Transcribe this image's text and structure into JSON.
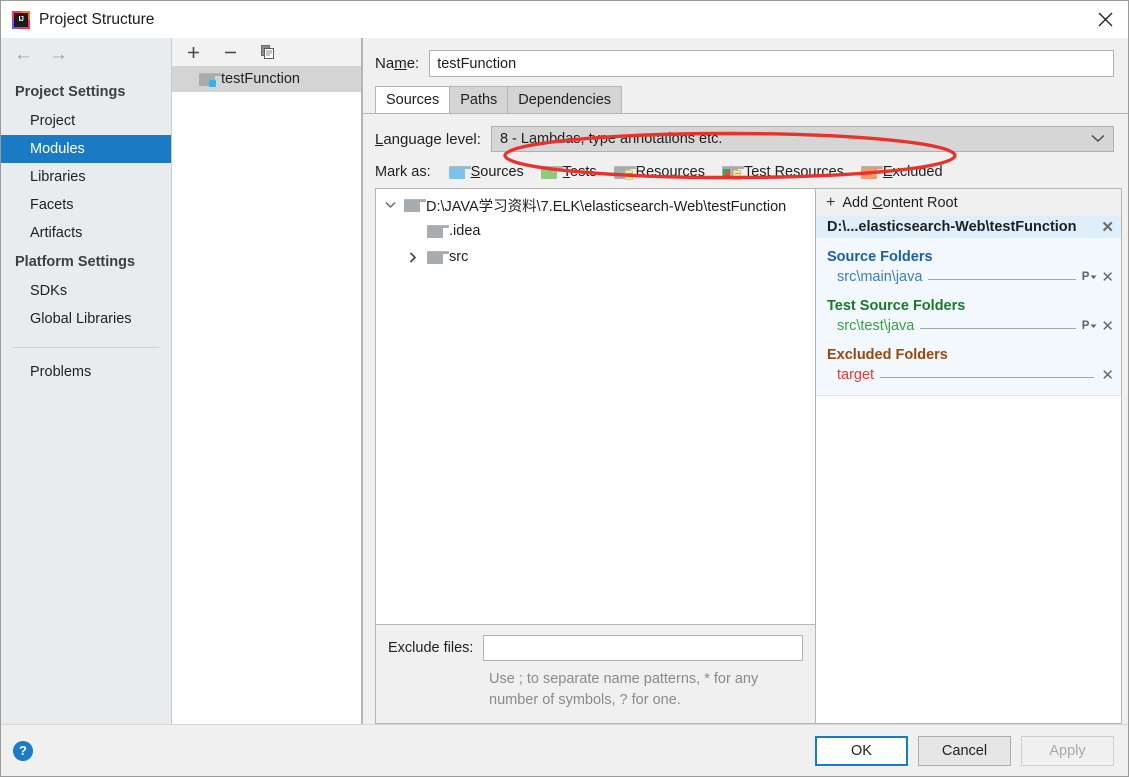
{
  "window": {
    "title": "Project Structure",
    "logo_icon": "intellij-idea-logo",
    "close_icon": "close-icon"
  },
  "sidebar": {
    "back_icon": "arrow-left-icon",
    "forward_icon": "arrow-right-icon",
    "groups": [
      {
        "label": "Project Settings",
        "items": [
          {
            "label": "Project",
            "selected": false
          },
          {
            "label": "Modules",
            "selected": true
          },
          {
            "label": "Libraries",
            "selected": false
          },
          {
            "label": "Facets",
            "selected": false
          },
          {
            "label": "Artifacts",
            "selected": false
          }
        ]
      },
      {
        "label": "Platform Settings",
        "items": [
          {
            "label": "SDKs",
            "selected": false
          },
          {
            "label": "Global Libraries",
            "selected": false
          }
        ]
      }
    ],
    "problems_label": "Problems",
    "selected_color": "#1a7bc4"
  },
  "modules": {
    "toolbar": {
      "add_icon": "plus-icon",
      "remove_icon": "minus-icon",
      "copy_icon": "copy-icon"
    },
    "items": [
      {
        "label": "testFunction",
        "icon": "module-folder-icon",
        "selected": true
      }
    ]
  },
  "detail": {
    "name_label": "Name:",
    "name_label_mnemonic": "m",
    "name_value": "testFunction",
    "name_placeholder": "",
    "tabs": [
      {
        "label": "Sources",
        "active": true
      },
      {
        "label": "Paths",
        "active": false
      },
      {
        "label": "Dependencies",
        "active": false
      }
    ],
    "language_level": {
      "label": "Language level:",
      "value": "8 - Lambdas, type annotations etc.",
      "chevron_icon": "chevron-down-icon"
    },
    "mark_as": {
      "label": "Mark as:",
      "options": [
        {
          "label": "Sources",
          "color": "blue",
          "icon": "folder-sources-icon"
        },
        {
          "label": "Tests",
          "color": "green",
          "icon": "folder-tests-icon"
        },
        {
          "label": "Resources",
          "color": "gray",
          "icon": "folder-resources-icon"
        },
        {
          "label": "Test Resources",
          "color": "mixed",
          "icon": "folder-test-resources-icon"
        },
        {
          "label": "Excluded",
          "color": "orange",
          "icon": "folder-excluded-icon"
        }
      ]
    },
    "tree": [
      {
        "label": "D:\\JAVA学习资料\\7.ELK\\elasticsearch-Web\\testFunction",
        "depth": 0,
        "twisty": "expanded",
        "icon": "folder-icon"
      },
      {
        "label": ".idea",
        "depth": 1,
        "twisty": "none",
        "icon": "folder-icon"
      },
      {
        "label": "src",
        "depth": 1,
        "twisty": "collapsed",
        "icon": "folder-icon"
      }
    ],
    "exclude_files": {
      "label": "Exclude files:",
      "value": "",
      "placeholder": "",
      "hint_line1": "Use ; to separate name patterns, * for any",
      "hint_line2": "number of symbols, ? for one."
    }
  },
  "content_roots": {
    "add_label": "Add Content Root",
    "add_icon": "plus-icon",
    "root_path": "D:\\...elasticsearch-Web\\testFunction",
    "remove_icon": "close-icon",
    "groups": [
      {
        "title": "Source Folders",
        "kind": "src",
        "color": "#1a5fa8",
        "rows": [
          {
            "value": "src\\main\\java",
            "package_prefix_icon": "package-prefix-icon",
            "remove_icon": "close-icon"
          }
        ]
      },
      {
        "title": "Test Source Folders",
        "kind": "test",
        "color": "#1a7a28",
        "rows": [
          {
            "value": "src\\test\\java",
            "package_prefix_icon": "package-prefix-icon",
            "remove_icon": "close-icon"
          }
        ]
      },
      {
        "title": "Excluded Folders",
        "kind": "excl",
        "color": "#9a4a10",
        "rows": [
          {
            "value": "target",
            "package_prefix_icon": "",
            "remove_icon": "close-icon"
          }
        ]
      }
    ]
  },
  "footer": {
    "help_icon": "help-icon",
    "help_label": "?",
    "ok_label": "OK",
    "cancel_label": "Cancel",
    "apply_label": "Apply",
    "apply_disabled": true
  },
  "annotation": {
    "shape": "ellipse",
    "color": "#e8322b",
    "target": "language-level-combobox"
  }
}
